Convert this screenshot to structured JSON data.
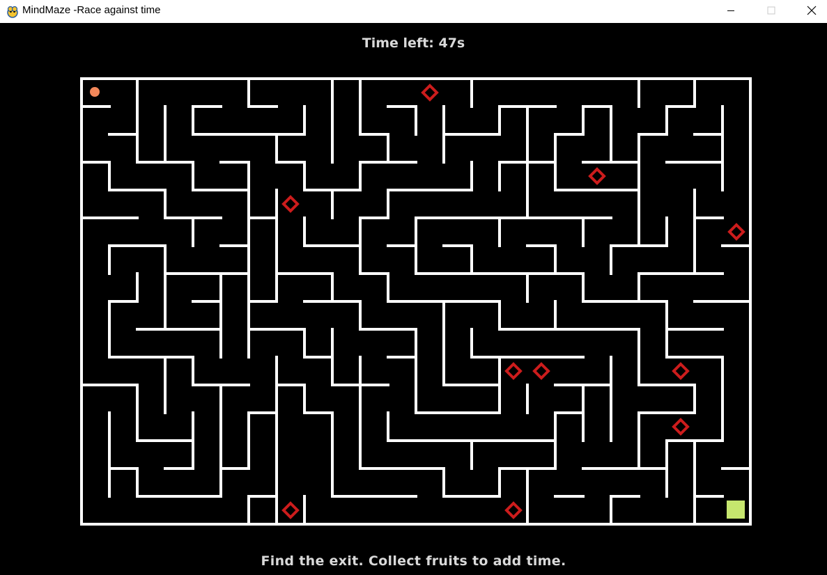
{
  "window": {
    "title": "MindMaze -Race against time",
    "controls": [
      "minimize",
      "maximize",
      "close"
    ]
  },
  "hud": {
    "timer_label": "Time left: 47s",
    "time_left_seconds": 47,
    "hint": "Find the exit. Collect fruits to add time."
  },
  "maze": {
    "columns": 24,
    "rows": 16,
    "wall_color": "#ffffff",
    "background_color": "#000000",
    "player": {
      "cell": [
        0,
        0
      ],
      "color": "#f2875a"
    },
    "exit": {
      "cell": [
        23,
        15
      ],
      "color": "#c6e66e"
    },
    "fruit_color": "#cc1c1c",
    "fruits": [
      [
        12,
        0
      ],
      [
        18,
        3
      ],
      [
        7,
        4
      ],
      [
        23,
        5
      ],
      [
        15,
        10
      ],
      [
        16,
        10
      ],
      [
        21,
        10
      ],
      [
        21,
        12
      ],
      [
        7,
        15
      ],
      [
        15,
        15
      ]
    ]
  }
}
